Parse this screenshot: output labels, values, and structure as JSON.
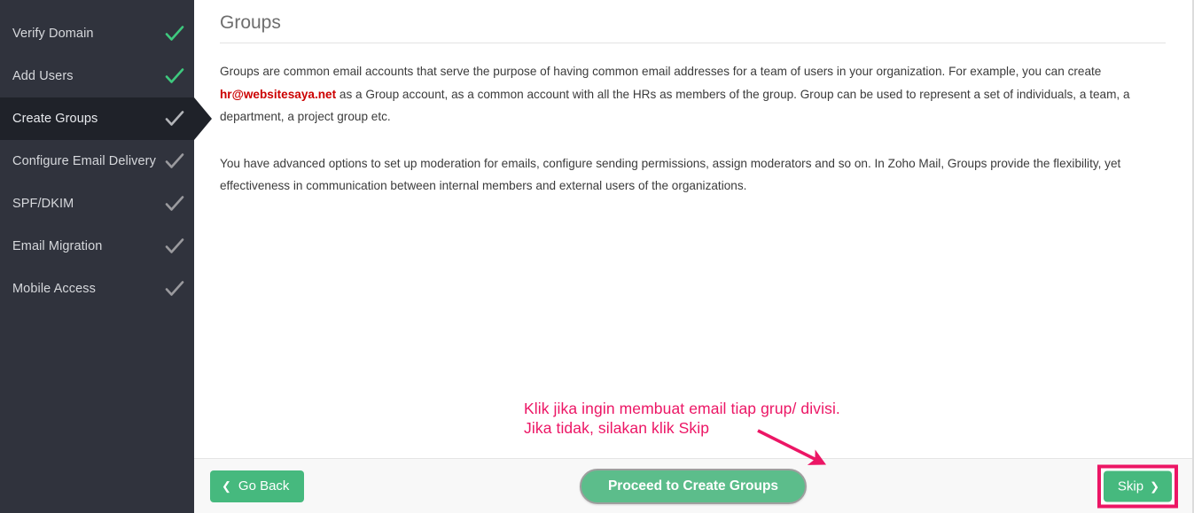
{
  "sidebar": {
    "items": [
      {
        "label": "Verify Domain",
        "check": "check-icon",
        "check_state": "complete",
        "active": false
      },
      {
        "label": "Add Users",
        "check": "check-icon",
        "check_state": "complete",
        "active": false
      },
      {
        "label": "Create Groups",
        "check": "check-icon",
        "check_state": "pending",
        "active": true
      },
      {
        "label": "Configure Email Delivery",
        "check": "check-icon",
        "check_state": "pending",
        "active": false
      },
      {
        "label": "SPF/DKIM",
        "check": "check-icon",
        "check_state": "pending",
        "active": false
      },
      {
        "label": "Email Migration",
        "check": "check-icon",
        "check_state": "pending",
        "active": false
      },
      {
        "label": "Mobile Access",
        "check": "check-icon",
        "check_state": "pending",
        "active": false
      }
    ]
  },
  "main": {
    "title": "Groups",
    "paragraph1_before": "Groups are common email accounts that serve the purpose of having common email addresses for a team of users in your organization. For example, you can create ",
    "paragraph1_link": "hr@websitesaya.net",
    "paragraph1_after": " as a Group account, as a common account with all the HRs as members of the group. Group can be used to represent a set of individuals, a team, a department, a project group etc.",
    "paragraph2": "You have advanced options to set up moderation for emails, configure sending permissions, assign moderators and so on. In Zoho Mail, Groups provide the flexibility, yet effectiveness in communication between internal members and external users of the organizations."
  },
  "annotation": {
    "text": "Klik jika ingin membuat email tiap grup/ divisi.\nJika tidak, silakan klik Skip",
    "color": "#ec1665",
    "arrow": "arrow-pointing-down-right-icon"
  },
  "footer": {
    "go_back_label": "Go Back",
    "go_back_chevron": "chevron-left-icon",
    "proceed_label": "Proceed to Create Groups",
    "skip_label": "Skip",
    "skip_chevron": "chevron-right-icon"
  },
  "colors": {
    "sidebar_bg": "#30333d",
    "sidebar_active_bg": "#1f2229",
    "check_complete": "#3ec97e",
    "check_pending": "#9a9a9e",
    "button_green": "#46b97e",
    "proceed_green": "#5cbd8b",
    "highlight_pink": "#ec1665",
    "link_red": "#cc0000",
    "title_gray": "#6e6e6e",
    "footer_bg": "#f8f8f8"
  }
}
